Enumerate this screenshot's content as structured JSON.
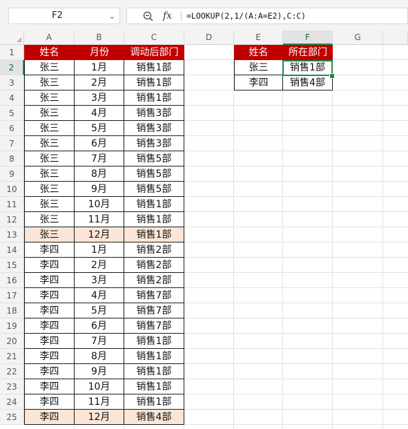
{
  "name_box": {
    "value": "F2"
  },
  "formula_bar": {
    "formula": "=LOOKUP(2,1/(A:A=E2),C:C)",
    "fx_label": "fx",
    "zoom_icon": "zoom-out-icon",
    "chevron_icon": "chevron-down-icon"
  },
  "columns": [
    "A",
    "B",
    "C",
    "D",
    "E",
    "F",
    "G"
  ],
  "active": {
    "col": "F",
    "row": "2"
  },
  "rows": [
    "1",
    "2",
    "3",
    "4",
    "5",
    "6",
    "7",
    "8",
    "9",
    "10",
    "11",
    "12",
    "13",
    "14",
    "15",
    "16",
    "17",
    "18",
    "19",
    "20",
    "21",
    "22",
    "23",
    "24",
    "25"
  ],
  "table_main": {
    "headers": [
      "姓名",
      "月份",
      "调动后部门"
    ],
    "rows": [
      [
        "张三",
        "1月",
        "销售1部"
      ],
      [
        "张三",
        "2月",
        "销售1部"
      ],
      [
        "张三",
        "3月",
        "销售1部"
      ],
      [
        "张三",
        "4月",
        "销售3部"
      ],
      [
        "张三",
        "5月",
        "销售3部"
      ],
      [
        "张三",
        "6月",
        "销售3部"
      ],
      [
        "张三",
        "7月",
        "销售5部"
      ],
      [
        "张三",
        "8月",
        "销售5部"
      ],
      [
        "张三",
        "9月",
        "销售5部"
      ],
      [
        "张三",
        "10月",
        "销售1部"
      ],
      [
        "张三",
        "11月",
        "销售1部"
      ],
      [
        "张三",
        "12月",
        "销售1部"
      ],
      [
        "李四",
        "1月",
        "销售2部"
      ],
      [
        "李四",
        "2月",
        "销售2部"
      ],
      [
        "李四",
        "3月",
        "销售2部"
      ],
      [
        "李四",
        "4月",
        "销售7部"
      ],
      [
        "李四",
        "5月",
        "销售7部"
      ],
      [
        "李四",
        "6月",
        "销售7部"
      ],
      [
        "李四",
        "7月",
        "销售1部"
      ],
      [
        "李四",
        "8月",
        "销售1部"
      ],
      [
        "李四",
        "9月",
        "销售1部"
      ],
      [
        "李四",
        "10月",
        "销售1部"
      ],
      [
        "李四",
        "11月",
        "销售1部"
      ],
      [
        "李四",
        "12月",
        "销售4部"
      ]
    ],
    "highlight_rows": [
      11,
      23
    ]
  },
  "table_lookup": {
    "headers": [
      "姓名",
      "所在部门"
    ],
    "rows": [
      [
        "张三",
        "销售1部"
      ],
      [
        "李四",
        "销售4部"
      ]
    ]
  },
  "colors": {
    "header_fill": "#c00000",
    "highlight_fill": "#fbe5d6",
    "selection": "#1e8a4c"
  }
}
